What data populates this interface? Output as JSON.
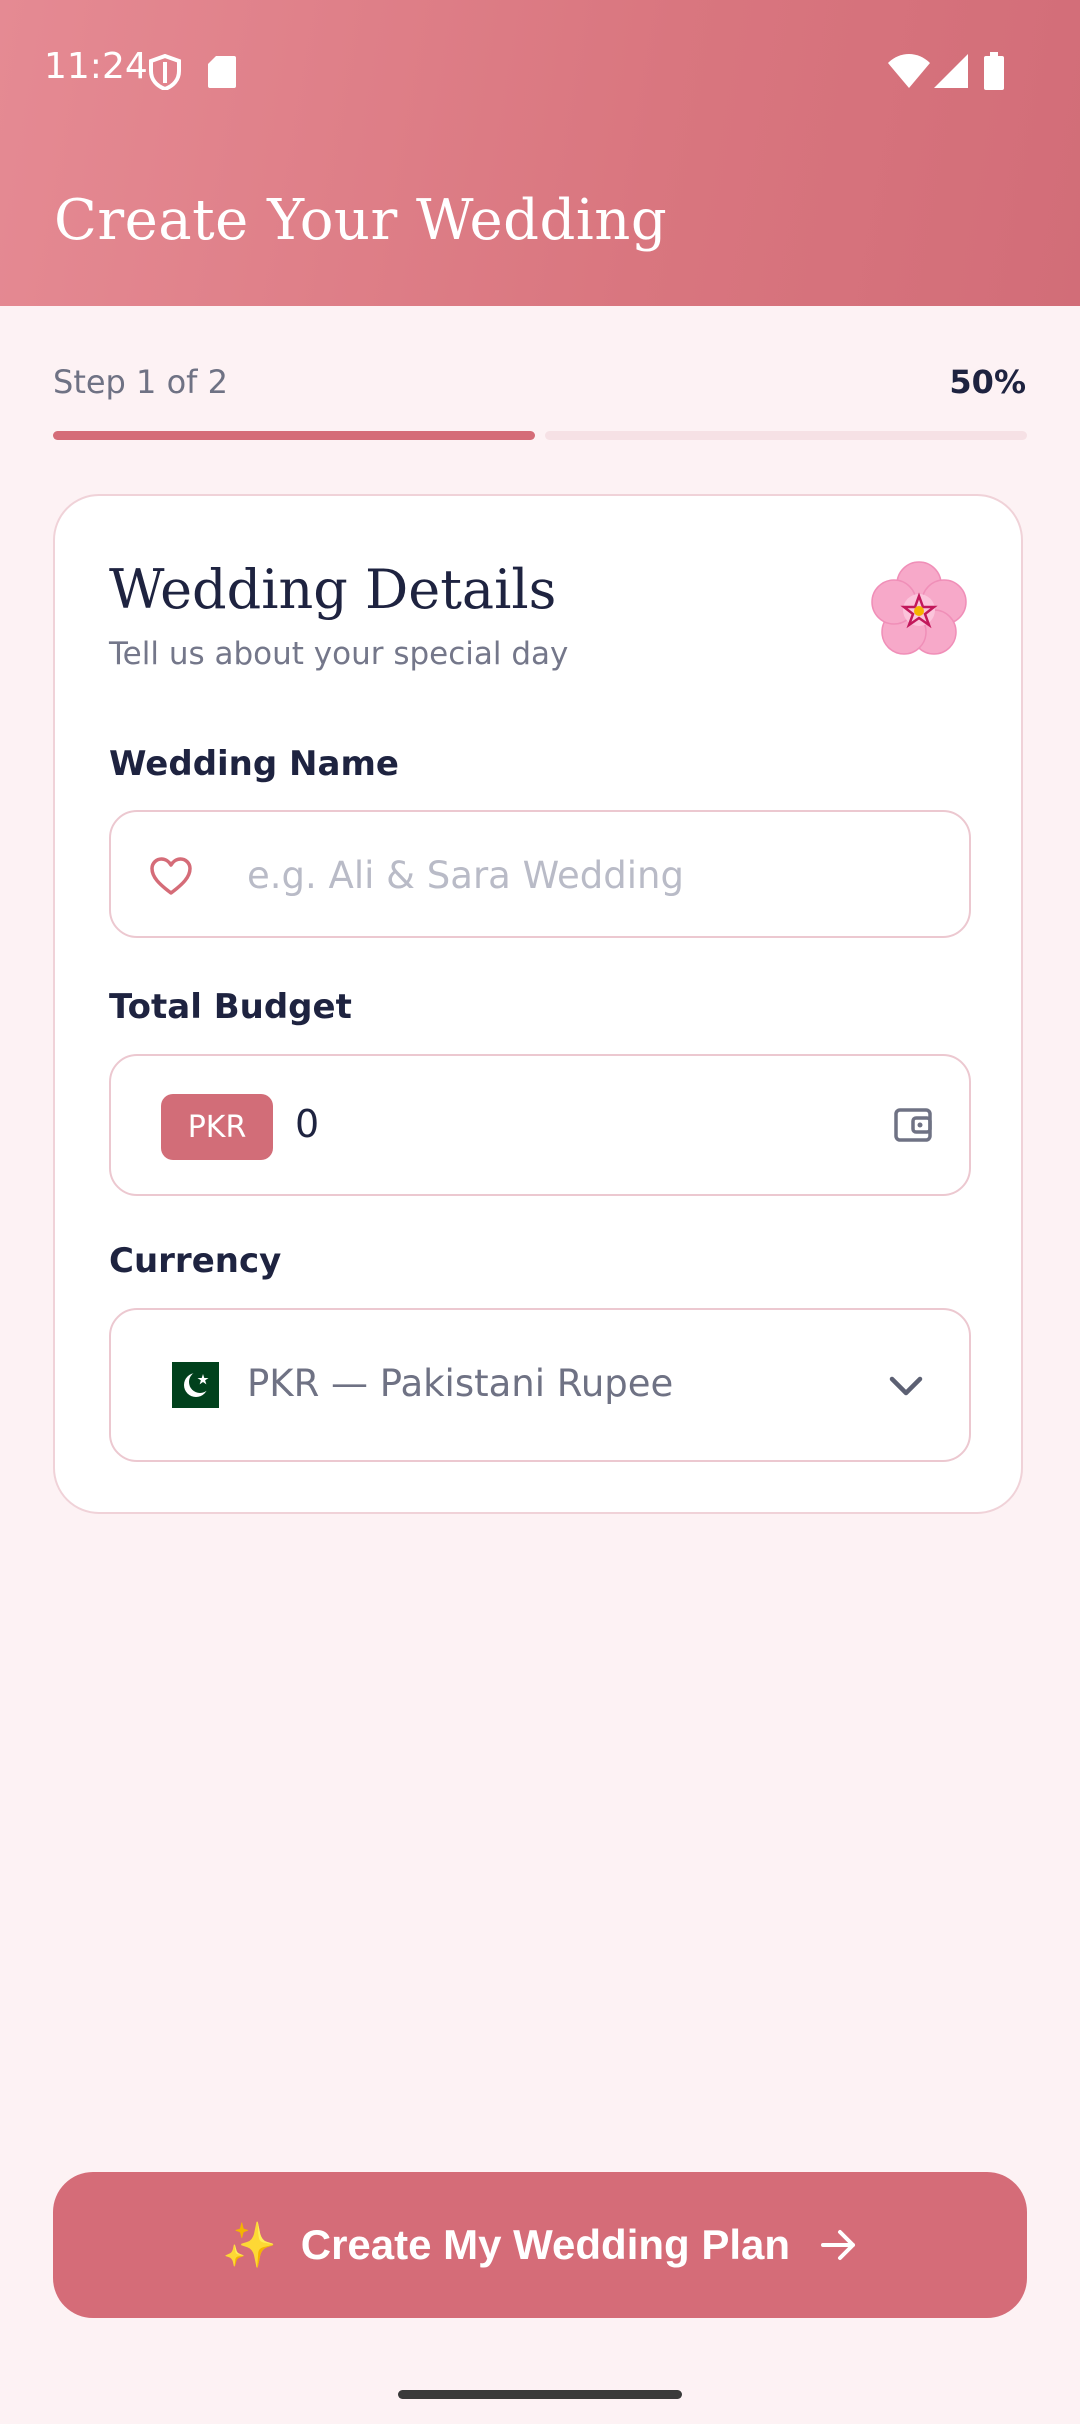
{
  "status_bar": {
    "time": "11:24"
  },
  "header": {
    "title": "Create Your Wedding"
  },
  "progress": {
    "step_text": "Step 1 of 2",
    "percent_text": "50%",
    "fraction": 0.5
  },
  "card": {
    "title": "Wedding Details",
    "subtitle": "Tell us about your special day",
    "wedding_name": {
      "label": "Wedding Name",
      "placeholder": "e.g. Ali & Sara Wedding",
      "value": ""
    },
    "total_budget": {
      "label": "Total Budget",
      "currency_badge": "PKR",
      "value": "0"
    },
    "currency": {
      "label": "Currency",
      "selected": "PKR — Pakistani Rupee"
    }
  },
  "cta": {
    "label": "Create My Wedding Plan",
    "sparkle": "✨"
  },
  "colors": {
    "accent": "#d56c78",
    "header_start": "#e58a93",
    "header_end": "#d26d78",
    "background": "#fdf2f4",
    "progress_track": "#f6e1e5",
    "text_dark": "#1e2340",
    "text_muted": "#6f7284"
  },
  "icons": [
    "shield-icon",
    "sd-card-icon",
    "wifi-icon",
    "signal-icon",
    "battery-icon",
    "flower-icon",
    "heart-icon",
    "wallet-icon",
    "pakistan-flag-icon",
    "chevron-down-icon",
    "arrow-right-icon"
  ]
}
